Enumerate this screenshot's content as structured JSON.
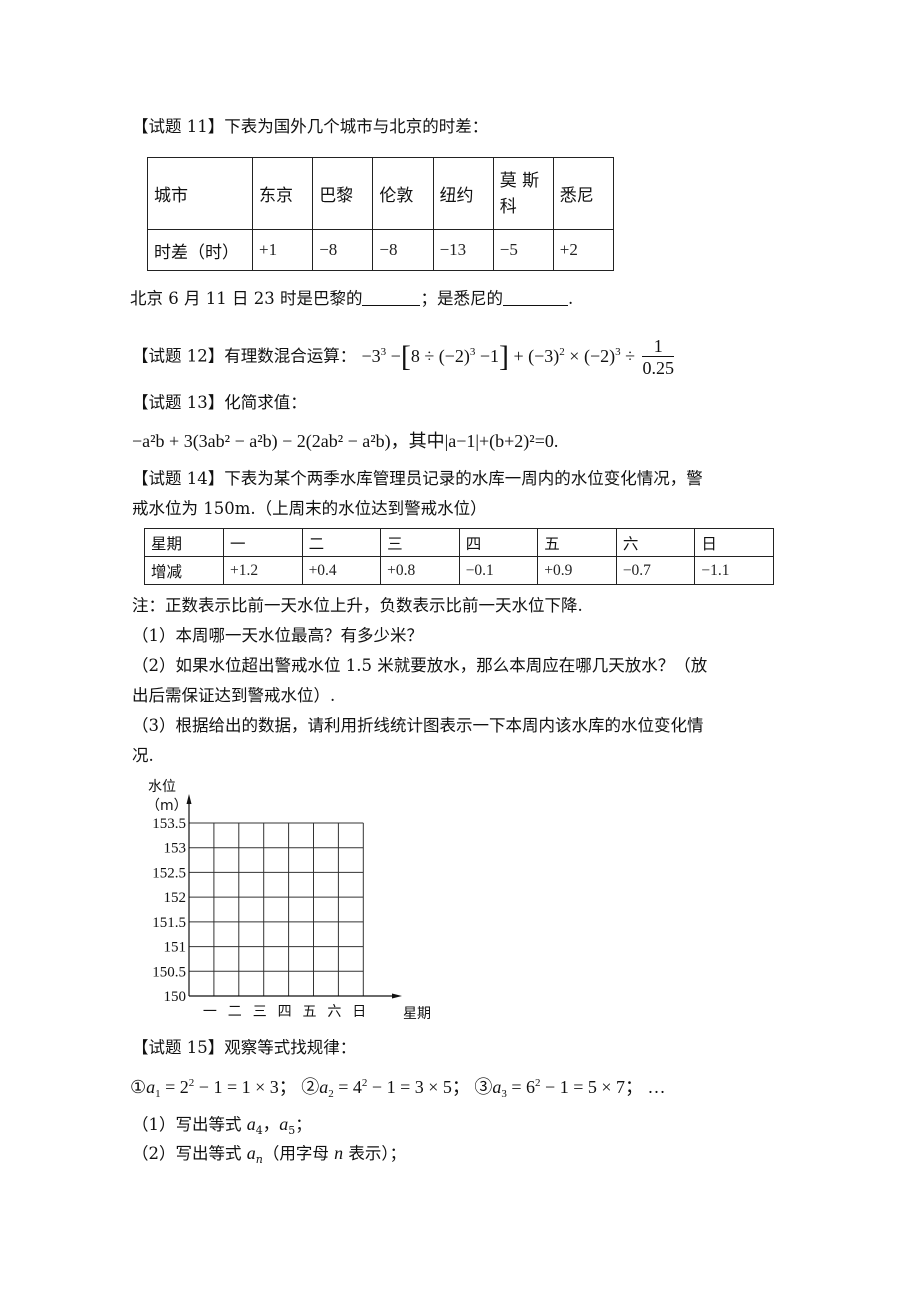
{
  "q11": {
    "label": "【试题 11】",
    "text": "下表为国外几个城市与北京的时差：",
    "table": {
      "row_headers": [
        "城市",
        "时差（时）"
      ],
      "cities": [
        "东京",
        "巴黎",
        "伦敦",
        "纽约",
        "莫 斯科",
        "悉尼"
      ],
      "diffs": [
        "+1",
        "−8",
        "−8",
        "−13",
        "−5",
        "+2"
      ]
    },
    "question_part1": "北京 6 月 11 日 23 时是巴黎的",
    "question_part2": "；是悉尼的",
    "question_end": "."
  },
  "q12": {
    "label": "【试题 12】",
    "text": "有理数混合运算：",
    "expr": {
      "a": "−3",
      "a_exp": "3",
      "minus": " −",
      "bracket_open": "[",
      "inner": "8 ÷ (−2)",
      "inner_exp": "3",
      "inner_tail": " −1",
      "bracket_close": "]",
      "b": " + (−3)",
      "b_exp": "2",
      "c": " × (−2)",
      "c_exp": "3",
      "div": " ÷ ",
      "frac_num": "1",
      "frac_den": "0.25"
    }
  },
  "q13": {
    "label": "【试题 13】",
    "text": "化简求值：",
    "expr_text": "−a²b + 3(3ab² − a²b) − 2(2ab² − a²b)，其中|a−1|+(b+2)²=0."
  },
  "q14": {
    "label": "【试题 14】",
    "text_line1": "下表为某个两季水库管理员记录的水库一周内的水位变化情况，警",
    "text_line2": "戒水位为 150m.（上周末的水位达到警戒水位）",
    "table": {
      "row_headers": [
        "星期",
        "增减"
      ],
      "days": [
        "一",
        "二",
        "三",
        "四",
        "五",
        "六",
        "日"
      ],
      "changes": [
        "+1.2",
        "+0.4",
        "+0.8",
        "−0.1",
        "+0.9",
        "−0.7",
        "−1.1"
      ]
    },
    "note": "注：正数表示比前一天水位上升，负数表示比前一天水位下降.",
    "sub1": "（1）本周哪一天水位最高？有多少米？",
    "sub2_line1": "（2）如果水位超出警戒水位 1.5 米就要放水，那么本周应在哪几天放水？（放",
    "sub2_line2": "出后需保证达到警戒水位）.",
    "sub3_line1": "（3）根据给出的数据，请利用折线统计图表示一下本周内该水库的水位变化情",
    "sub3_line2": "况."
  },
  "chart_data": {
    "type": "line",
    "title": "",
    "ylabel": "水位",
    "yunit": "（m）",
    "xlabel": "星期",
    "categories": [
      "一",
      "二",
      "三",
      "四",
      "五",
      "六",
      "日"
    ],
    "series": [],
    "yticks": [
      "150",
      "150.5",
      "151",
      "151.5",
      "152",
      "152.5",
      "153",
      "153.5"
    ],
    "ylim": [
      150,
      153.5
    ],
    "grid": true,
    "note": "blank grid for student to plot"
  },
  "q15": {
    "label": "【试题 15】",
    "text": "观察等式找规律：",
    "items": [
      {
        "mark": "①",
        "lhs": "a",
        "sub": "1",
        "base": "2",
        "rest": " − 1 = 1 × 3"
      },
      {
        "mark": "②",
        "lhs": "a",
        "sub": "2",
        "base": "4",
        "rest": " − 1 = 3 × 5"
      },
      {
        "mark": "③",
        "lhs": "a",
        "sub": "3",
        "base": "6",
        "rest": " − 1 = 5 × 7"
      }
    ],
    "sep": "；",
    "ellipsis": "…",
    "sub1_pre": "（1）写出等式 ",
    "sub1_a4": "4",
    "sub1_mid": "，",
    "sub1_a5": "5",
    "sub1_end": "；",
    "sub2_pre": "（2）写出等式 ",
    "sub2_n": "n",
    "sub2_mid": "（用字母 ",
    "sub2_var": "n",
    "sub2_end": " 表示）；"
  }
}
